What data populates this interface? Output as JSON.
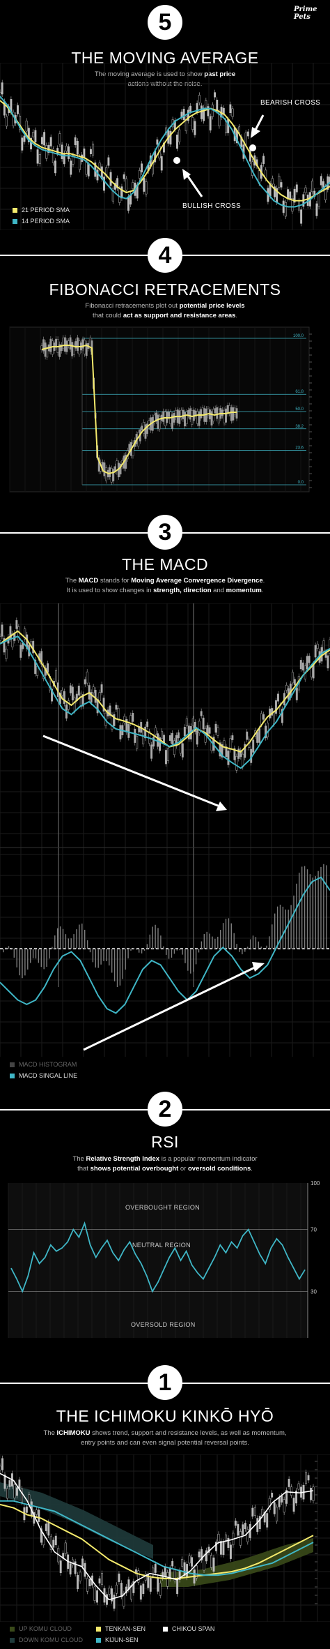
{
  "brand": "Prime Pets",
  "colors": {
    "yellow": "#f4ea6c",
    "teal": "#3fb6c6",
    "grid": "#1e1e1e",
    "white": "#ffffff"
  },
  "sections": {
    "ma": {
      "number": "5",
      "title": "THE MOVING AVERAGE",
      "subtitle_a": "The moving average is used to show ",
      "subtitle_b": "past price",
      "subtitle_c": "actions without the noise.",
      "bearish_label": "BEARISH CROSS",
      "bullish_label": "BULLISH CROSS",
      "legend_21": "21 PERIOD SMA",
      "legend_14": "14 PERIOD SMA"
    },
    "fib": {
      "number": "4",
      "title": "FIBONACCI RETRACEMENTS",
      "subtitle_a": "Fibonacci retracements plot out ",
      "subtitle_b": "potential price levels",
      "subtitle_c": "that could ",
      "subtitle_d": "act as support and resistance areas",
      "subtitle_e": "."
    },
    "macd": {
      "number": "3",
      "title": "THE MACD",
      "subtitle_a": "The ",
      "subtitle_b": "MACD",
      "subtitle_c": " stands for ",
      "subtitle_d": "Moving Average Convergence Divergence",
      "subtitle_e": ".",
      "subtitle_f": "It is used to show changes in ",
      "subtitle_g": "strength, direction",
      "subtitle_h": " and ",
      "subtitle_i": "momentum",
      "subtitle_j": ".",
      "legend_hist": "MACD HISTOGRAM",
      "legend_signal": "MACD SINGAL LINE"
    },
    "rsi": {
      "number": "2",
      "title": "RSI",
      "subtitle_a": "The ",
      "subtitle_b": "Relative Strength Index",
      "subtitle_c": " is a popular momentum indicator",
      "subtitle_d": "that ",
      "subtitle_e": "shows potential overbought",
      "subtitle_f": " or ",
      "subtitle_g": "oversold conditions",
      "subtitle_h": ".",
      "overbought": "OVERBOUGHT REGION",
      "neutral": "NEUTRAL REGION",
      "oversold": "OVERSOLD REGION"
    },
    "ichi": {
      "number": "1",
      "title": "THE ICHIMOKU KINKŌ HYŌ",
      "subtitle_a": "The ",
      "subtitle_b": "ICHIMOKU",
      "subtitle_c": " shows trend, support and resistance levels, as well as momentum,",
      "subtitle_d": "entry points and can even signal potential reversal points.",
      "legend_up": "UP KOMU CLOUD",
      "legend_down": "DOWN KOMU CLOUD",
      "legend_tenkan": "TENKAN-SEN",
      "legend_kijun": "KIJUN-SEN",
      "legend_chikou": "CHIKOU SPAN"
    }
  },
  "chart_data": [
    {
      "type": "line",
      "title": "THE MOVING AVERAGE",
      "x": [
        0,
        1,
        2,
        3,
        4,
        5,
        6,
        7,
        8,
        9,
        10,
        11,
        12,
        13,
        14,
        15,
        16,
        17,
        18,
        19,
        20,
        21,
        22,
        23,
        24,
        25,
        26,
        27,
        28,
        29,
        30,
        31,
        32,
        33,
        34,
        35,
        36,
        37,
        38,
        39,
        40,
        41,
        42,
        43,
        44,
        45,
        46,
        47
      ],
      "series": [
        {
          "name": "21 PERIOD SMA",
          "values": [
            80,
            77,
            72,
            67,
            62,
            59,
            57,
            56,
            55,
            54,
            54,
            53,
            52,
            50,
            47,
            44,
            40,
            37,
            35,
            36,
            40,
            45,
            51,
            57,
            62,
            66,
            69,
            72,
            74,
            75,
            76,
            75,
            73,
            69,
            64,
            58,
            52,
            46,
            41,
            37,
            34,
            32,
            31,
            31,
            32,
            34,
            36,
            38
          ]
        },
        {
          "name": "14 PERIOD SMA",
          "values": [
            82,
            78,
            72,
            66,
            61,
            58,
            56,
            55,
            54,
            53,
            53,
            52,
            51,
            48,
            44,
            40,
            36,
            33,
            32,
            35,
            41,
            48,
            55,
            61,
            66,
            70,
            72,
            74,
            75,
            76,
            76,
            74,
            71,
            66,
            59,
            52,
            45,
            39,
            35,
            31,
            29,
            28,
            28,
            29,
            31,
            34,
            37,
            40
          ]
        }
      ],
      "annotations": [
        "BEARISH CROSS",
        "BULLISH CROSS"
      ]
    },
    {
      "type": "line",
      "title": "FIBONACCI RETRACEMENTS",
      "y_levels": [
        100.0,
        61.8,
        50.0,
        38.2,
        23.6,
        0.0
      ],
      "series": [
        {
          "name": "",
          "values": [
            97,
            98,
            99,
            99,
            100,
            100,
            99,
            99,
            100,
            98,
            20,
            10,
            8,
            9,
            12,
            18,
            25,
            32,
            38,
            42,
            45,
            47,
            48,
            48,
            49,
            49,
            50,
            49,
            50,
            50,
            51,
            50,
            51,
            51,
            52,
            52
          ]
        }
      ]
    },
    {
      "type": "line",
      "title": "THE MACD",
      "series": [
        {
          "name": "MACD SINGAL LINE",
          "values": [
            -2,
            -6,
            -10,
            -12,
            -10,
            -4,
            4,
            10,
            12,
            8,
            0,
            -8,
            -14,
            -16,
            -12,
            -4,
            4,
            8,
            6,
            0,
            -6,
            -10,
            -6,
            2,
            10,
            14,
            10,
            4,
            0,
            2,
            6,
            14,
            22,
            30,
            38,
            44,
            46,
            40
          ]
        }
      ],
      "legend": [
        "MACD HISTOGRAM",
        "MACD SINGAL LINE"
      ]
    },
    {
      "type": "line",
      "title": "RSI",
      "ylim": [
        0,
        100
      ],
      "yticks": [
        100,
        70,
        30
      ],
      "series": [
        {
          "name": "",
          "values": [
            45,
            38,
            30,
            40,
            55,
            48,
            52,
            60,
            56,
            58,
            62,
            70,
            65,
            74,
            60,
            52,
            58,
            63,
            55,
            50,
            57,
            62,
            54,
            48,
            40,
            30,
            36,
            44,
            52,
            58,
            50,
            56,
            47,
            42,
            38,
            45,
            52,
            60,
            55,
            62,
            58,
            66,
            70,
            62,
            54,
            48,
            58,
            64,
            60,
            52,
            45,
            38,
            44
          ]
        }
      ],
      "annotations": [
        "OVERBOUGHT REGION",
        "NEUTRAL REGION",
        "OVERSOLD REGION"
      ]
    },
    {
      "type": "line",
      "title": "THE ICHIMOKU KINKŌ HYŌ",
      "series": [
        {
          "name": "TENKAN-SEN",
          "values": [
            70,
            68,
            64,
            62,
            58,
            54,
            50,
            44,
            38,
            34,
            30,
            28,
            27,
            27,
            28,
            29,
            30,
            31,
            33,
            36,
            40,
            44,
            48,
            52
          ]
        },
        {
          "name": "KIJUN-SEN",
          "values": [
            72,
            72,
            70,
            68,
            66,
            62,
            58,
            54,
            50,
            46,
            42,
            38,
            34,
            32,
            30,
            29,
            29,
            30,
            32,
            34,
            36,
            40,
            44,
            48
          ]
        },
        {
          "name": "CHIKOU SPAN",
          "values": [
            88,
            80,
            70,
            58,
            46,
            36,
            30,
            22,
            18,
            20,
            24,
            26,
            28,
            30,
            34,
            38,
            44,
            50,
            56,
            62,
            68,
            74,
            78,
            82
          ]
        }
      ],
      "legend": [
        "UP KOMU CLOUD",
        "DOWN KOMU CLOUD",
        "TENKAN-SEN",
        "KIJUN-SEN",
        "CHIKOU SPAN"
      ]
    }
  ]
}
